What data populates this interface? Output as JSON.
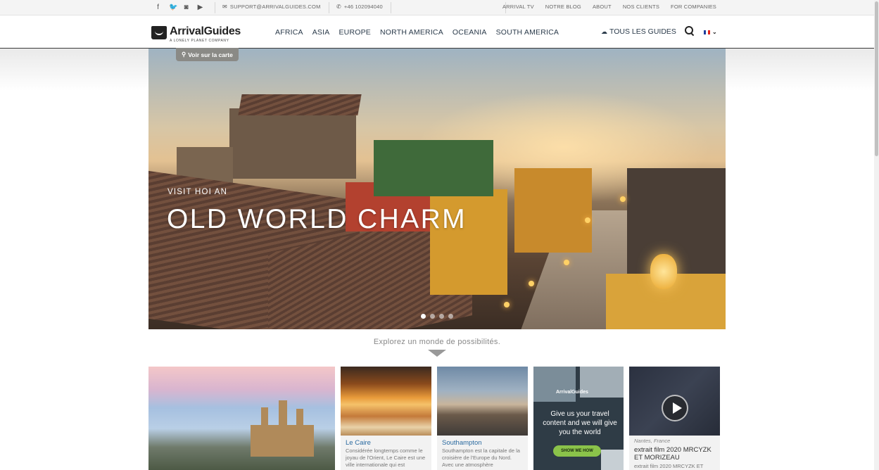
{
  "topbar": {
    "social": [
      {
        "icon": "facebook-icon",
        "glyph": "f"
      },
      {
        "icon": "twitter-icon",
        "glyph": "🐦"
      },
      {
        "icon": "instagram-icon",
        "glyph": "◙"
      },
      {
        "icon": "youtube-icon",
        "glyph": "▶"
      }
    ],
    "email": "SUPPORT@ARRIVALGUIDES.COM",
    "phone": "+46 102094040",
    "links": [
      "ARRIVAL TV",
      "NOTRE BLOG",
      "ABOUT",
      "NOS CLIENTS",
      "FOR COMPANIES"
    ]
  },
  "nav": {
    "logo_name": "ArrivalGuides",
    "logo_sub": "A LONELY PLANET COMPANY",
    "regions": [
      "AFRICA",
      "ASIA",
      "EUROPE",
      "NORTH AMERICA",
      "OCEANIA",
      "SOUTH AMERICA"
    ],
    "all_guides": "TOUS LES GUIDES",
    "language": "fr",
    "flag_colors": [
      "#1f3e9c",
      "#ffffff",
      "#e2231a"
    ]
  },
  "hero": {
    "map_button": "Voir sur la carte",
    "kicker": "VISIT HOI AN",
    "title": "OLD WORLD CHARM",
    "slides": 4,
    "active_slide": 1
  },
  "explore": "Explorez un monde de possibilités.",
  "cards": [
    {
      "title": "",
      "desc": ""
    },
    {
      "title": "Le Caire",
      "desc": "Considérée longtemps comme le joyau de l'Orient, Le Caire est une ville internationale qui est"
    },
    {
      "title": "Southampton",
      "desc": "Southampton est la capitale de la croisière de l'Europe du Nord. Avec une atmosphère"
    },
    {
      "ad_logo": "ArrivalGuides",
      "ad_text": "Give us your travel content and we will give you the world",
      "ad_button": "SHOW ME HOW"
    },
    {
      "location": "Nantes, France",
      "title": "extrait film 2020 MRCYZK ET MORIZEAU",
      "desc": "extrait film 2020 MRCYZK ET"
    }
  ]
}
